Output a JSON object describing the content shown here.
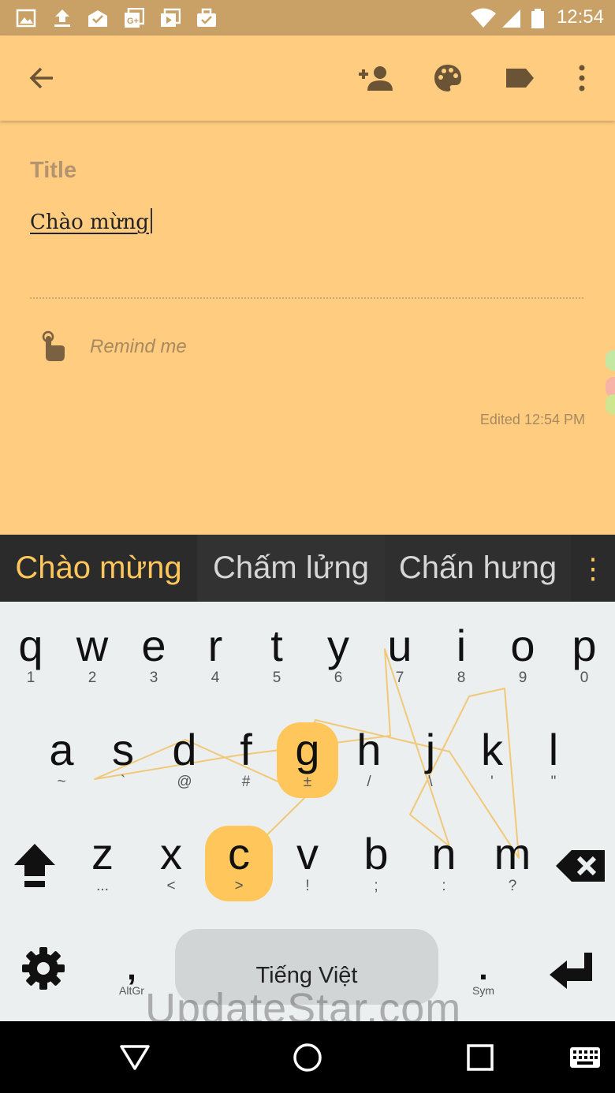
{
  "status_bar": {
    "time": "12:54",
    "left_icons": [
      "image-icon",
      "upload-icon",
      "mail-check-icon",
      "google-plus-icon",
      "media-icon",
      "briefcase-check-icon"
    ],
    "right_icons": [
      "wifi-icon",
      "signal-icon",
      "battery-icon"
    ]
  },
  "toolbar": {
    "icons": [
      "back-arrow-icon",
      "add-collaborator-icon",
      "palette-icon",
      "label-icon",
      "more-vert-icon"
    ]
  },
  "note": {
    "title_placeholder": "Title",
    "body": "Chào mừng",
    "remind_label": "Remind me",
    "edited": "Edited 12:54 PM"
  },
  "suggestions": {
    "primary": "Chào mừng",
    "items": [
      "Chấm lửng",
      "Chấn hưng"
    ],
    "more_symbol": "⋮"
  },
  "keyboard": {
    "highlight_color": "#FFC65C",
    "row1": [
      {
        "main": "q",
        "alt": "1"
      },
      {
        "main": "w",
        "alt": "2"
      },
      {
        "main": "e",
        "alt": "3"
      },
      {
        "main": "r",
        "alt": "4"
      },
      {
        "main": "t",
        "alt": "5"
      },
      {
        "main": "y",
        "alt": "6"
      },
      {
        "main": "u",
        "alt": "7"
      },
      {
        "main": "i",
        "alt": "8"
      },
      {
        "main": "o",
        "alt": "9"
      },
      {
        "main": "p",
        "alt": "0"
      }
    ],
    "row2": [
      {
        "main": "a",
        "alt": "~"
      },
      {
        "main": "s",
        "alt": "`"
      },
      {
        "main": "d",
        "alt": "@"
      },
      {
        "main": "f",
        "alt": "#"
      },
      {
        "main": "g",
        "alt": "±"
      },
      {
        "main": "h",
        "alt": "/"
      },
      {
        "main": "j",
        "alt": "\\"
      },
      {
        "main": "k",
        "alt": "'"
      },
      {
        "main": "l",
        "alt": "\""
      }
    ],
    "row3": [
      {
        "main": "z",
        "alt": "..."
      },
      {
        "main": "x",
        "alt": "<"
      },
      {
        "main": "c",
        "alt": ">"
      },
      {
        "main": "v",
        "alt": "!"
      },
      {
        "main": "b",
        "alt": ";"
      },
      {
        "main": "n",
        "alt": ":"
      },
      {
        "main": "m",
        "alt": "?"
      }
    ],
    "comma": {
      "main": ",",
      "alt": "AltGr"
    },
    "period": {
      "main": ".",
      "alt": "Sym"
    },
    "space_label": "Tiếng Việt",
    "func_icons": [
      "shift-icon",
      "backspace-icon",
      "settings-icon",
      "enter-icon"
    ]
  },
  "watermark": "UpdateStar.com",
  "nav_bar": {
    "icons": [
      "back-triangle-icon",
      "home-circle-icon",
      "recents-square-icon",
      "keyboard-switch-icon"
    ]
  }
}
